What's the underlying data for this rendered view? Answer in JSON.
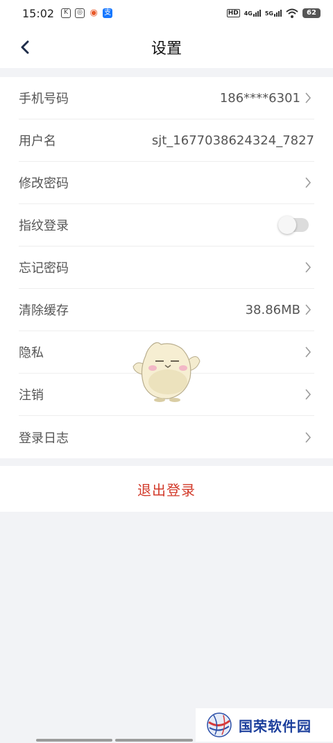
{
  "status_bar": {
    "time": "15:02",
    "hd": "HD",
    "net1": "4G",
    "net2": "5G",
    "battery": "62"
  },
  "header": {
    "title": "设置"
  },
  "settings": {
    "phone": {
      "label": "手机号码",
      "value": "186****6301"
    },
    "username": {
      "label": "用户名",
      "value": "sjt_1677038624324_7827"
    },
    "change_password": {
      "label": "修改密码"
    },
    "fingerprint": {
      "label": "指纹登录",
      "enabled": false
    },
    "forgot_password": {
      "label": "忘记密码"
    },
    "clear_cache": {
      "label": "清除缓存",
      "value": "38.86MB"
    },
    "privacy": {
      "label": "隐私"
    },
    "deregister": {
      "label": "注销"
    },
    "login_log": {
      "label": "登录日志"
    }
  },
  "logout": {
    "label": "退出登录"
  },
  "watermark": {
    "text": "国荣软件园"
  },
  "colors": {
    "accent_red": "#d23a2a",
    "background": "#f2f3f6",
    "watermark_blue": "#1c3f9c"
  }
}
